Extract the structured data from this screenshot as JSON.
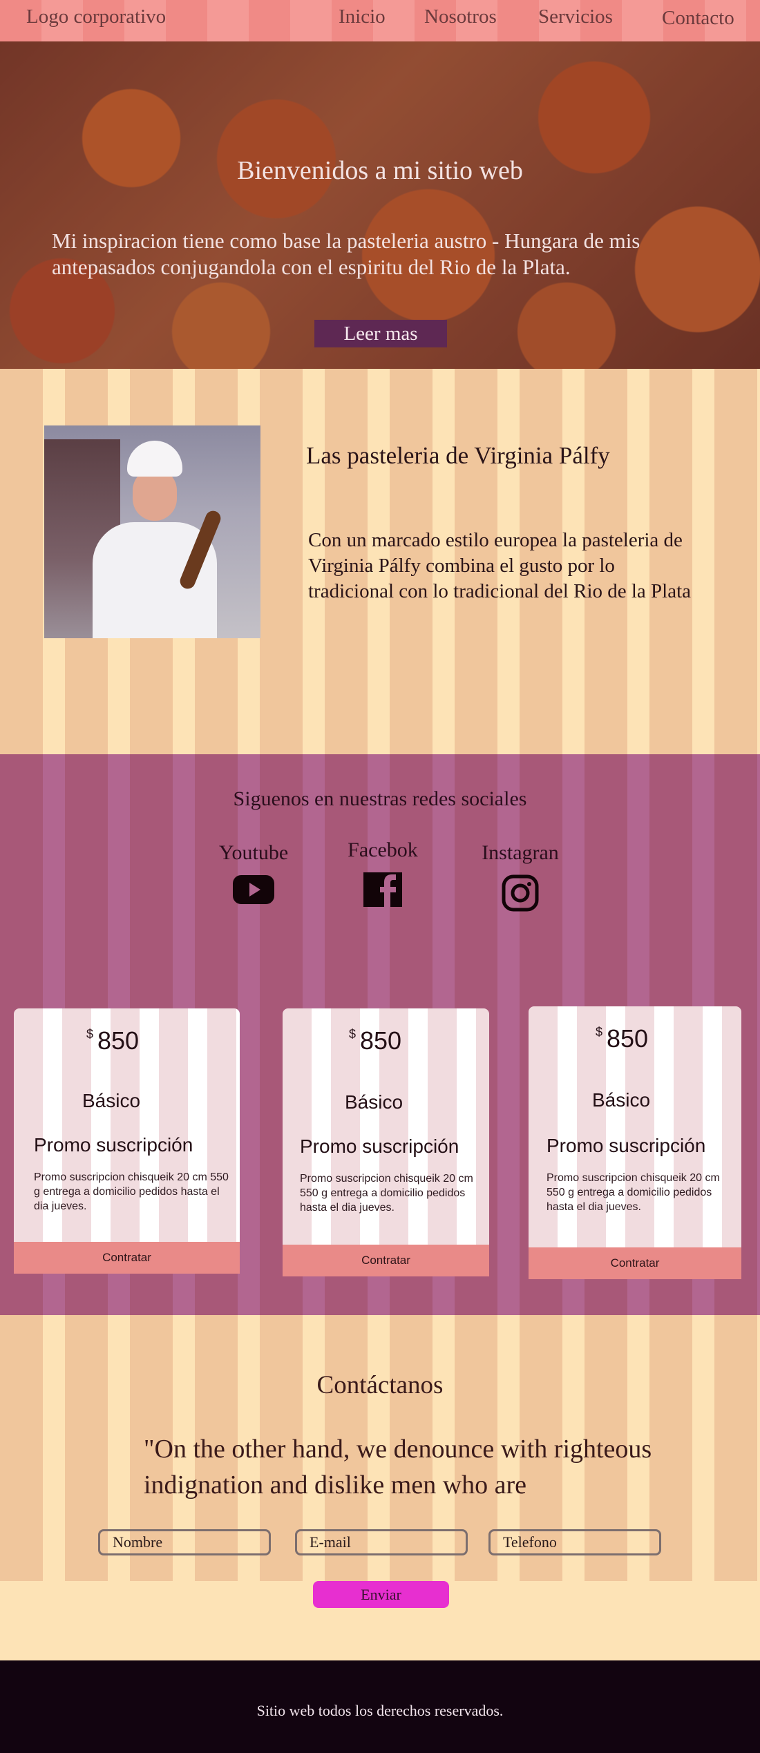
{
  "nav": {
    "logo": "Logo corporativo",
    "links": [
      "Inicio",
      "Nosotros",
      "Servicios",
      "Contacto"
    ]
  },
  "hero": {
    "title": "Bienvenidos a mi sitio web",
    "lead": "Mi inspiracion tiene como base la pasteleria austro - Hungara de mis antepasados conjugandola con el espiritu del Rio de la Plata.",
    "button": "Leer mas"
  },
  "about": {
    "title": "Las pasteleria de Virginia Pálfy",
    "text": "Con un marcado estilo europea la pasteleria de Virginia Pálfy combina el gusto por lo tradicional con lo tradicional del Rio de la Plata"
  },
  "social": {
    "heading": "Siguenos en nuestras redes sociales",
    "items": [
      {
        "label": "Youtube",
        "icon": "youtube-icon"
      },
      {
        "label": "Facebok",
        "icon": "facebook-icon"
      },
      {
        "label": "Instagran",
        "icon": "instagram-icon"
      }
    ]
  },
  "pricing": {
    "cards": [
      {
        "currency": "$",
        "price": "850",
        "tier": "Básico",
        "name": "Promo suscripción",
        "desc": "Promo suscripcion chisqueik 20 cm 550 g entrega a domicilio pedidos hasta el dia jueves.",
        "cta": "Contratar"
      },
      {
        "currency": "$",
        "price": "850",
        "tier": "Básico",
        "name": "Promo suscripción",
        "desc": "Promo suscripcion chisqueik 20 cm 550 g entrega a domicilio pedidos hasta el dia jueves.",
        "cta": "Contratar"
      },
      {
        "currency": "$",
        "price": "850",
        "tier": "Básico",
        "name": "Promo suscripción",
        "desc": "Promo suscripcion chisqueik 20 cm 550 g entrega a domicilio pedidos hasta el dia jueves.",
        "cta": "Contratar"
      }
    ]
  },
  "contact": {
    "title": "Contáctanos",
    "quote": "\"On the other hand, we denounce with righteous indignation and dislike men who are",
    "fields": {
      "name_placeholder": "Nombre",
      "email_placeholder": "E-mail",
      "phone_placeholder": "Telefono"
    },
    "send": "Enviar"
  },
  "footer": {
    "text": "Sitio web  todos los derechos reservados."
  },
  "colors": {
    "nav": "#f08a86",
    "hero_button": "#5e2853",
    "purple_section": "#a85878",
    "card_cta": "#e98a88",
    "send_button": "#e72fd0",
    "footer": "#120410"
  }
}
